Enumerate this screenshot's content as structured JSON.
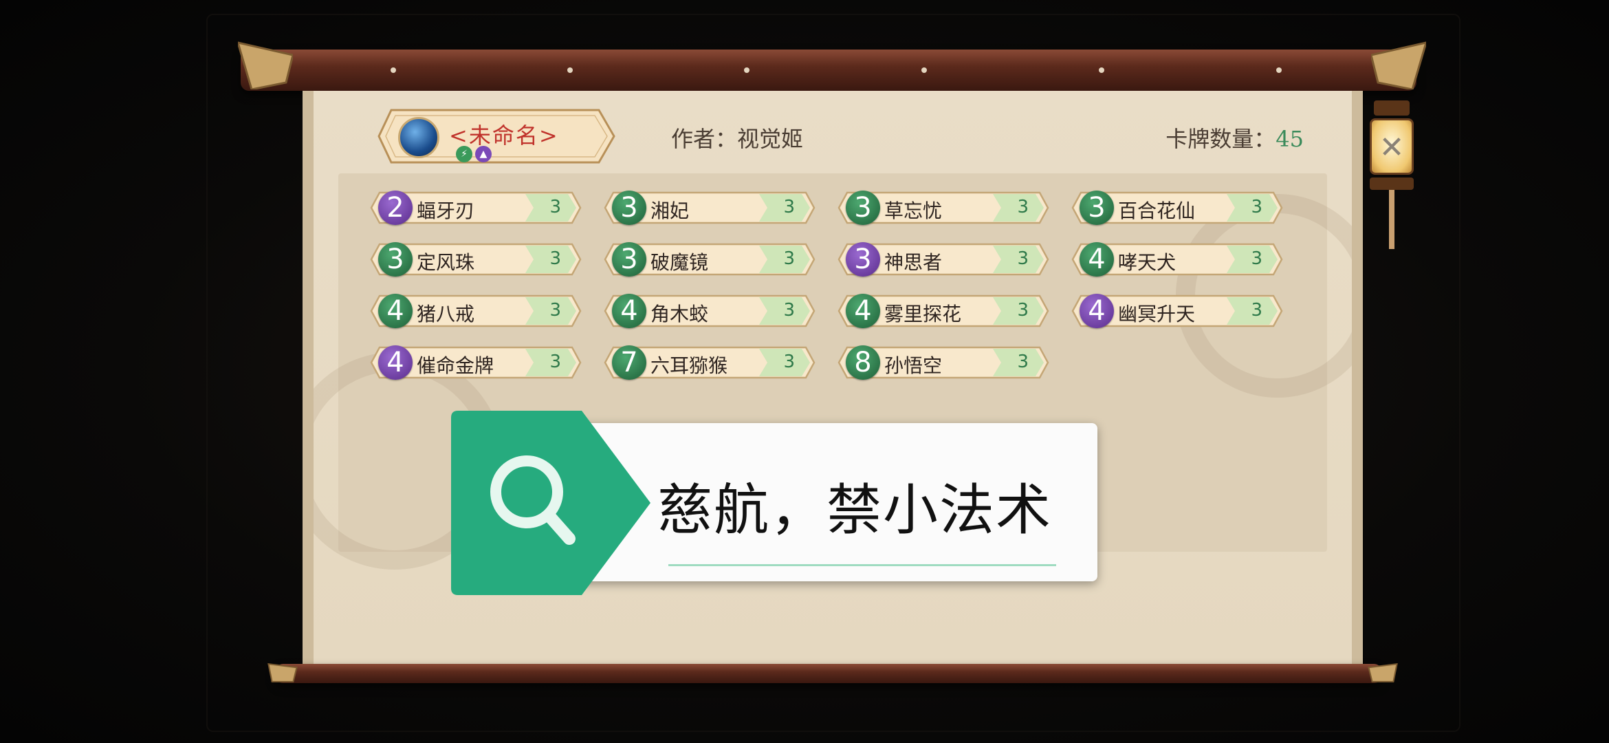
{
  "deck": {
    "name": "<未命名>",
    "author": "作者：视觉姬",
    "count_label": "卡牌数量：",
    "count_value": "45",
    "badges": [
      "⚡",
      "▲"
    ]
  },
  "cards": [
    {
      "cost": "2",
      "name": "蝠牙刃",
      "qty": "3",
      "color": "purple"
    },
    {
      "cost": "3",
      "name": "湘妃",
      "qty": "3",
      "color": "green"
    },
    {
      "cost": "3",
      "name": "草忘忧",
      "qty": "3",
      "color": "green"
    },
    {
      "cost": "3",
      "name": "百合花仙",
      "qty": "3",
      "color": "green"
    },
    {
      "cost": "3",
      "name": "定风珠",
      "qty": "3",
      "color": "green"
    },
    {
      "cost": "3",
      "name": "破魔镜",
      "qty": "3",
      "color": "green"
    },
    {
      "cost": "3",
      "name": "神思者",
      "qty": "3",
      "color": "purple"
    },
    {
      "cost": "4",
      "name": "哮天犬",
      "qty": "3",
      "color": "green"
    },
    {
      "cost": "4",
      "name": "猪八戒",
      "qty": "3",
      "color": "green"
    },
    {
      "cost": "4",
      "name": "角木蛟",
      "qty": "3",
      "color": "green"
    },
    {
      "cost": "4",
      "name": "雾里探花",
      "qty": "3",
      "color": "green"
    },
    {
      "cost": "4",
      "name": "幽冥升天",
      "qty": "3",
      "color": "purple"
    },
    {
      "cost": "4",
      "name": "催命金牌",
      "qty": "3",
      "color": "purple"
    },
    {
      "cost": "7",
      "name": "六耳猕猴",
      "qty": "3",
      "color": "green"
    },
    {
      "cost": "8",
      "name": "孙悟空",
      "qty": "3",
      "color": "green"
    }
  ],
  "close": {
    "icon": "close-icon",
    "glyph": "✕"
  },
  "search": {
    "icon": "search-icon",
    "text": "慈航，禁小法术"
  },
  "colors": {
    "accent_green": "#26a97d",
    "card_qty_bg": "#cfe6b8",
    "title_red": "#c0322b"
  }
}
